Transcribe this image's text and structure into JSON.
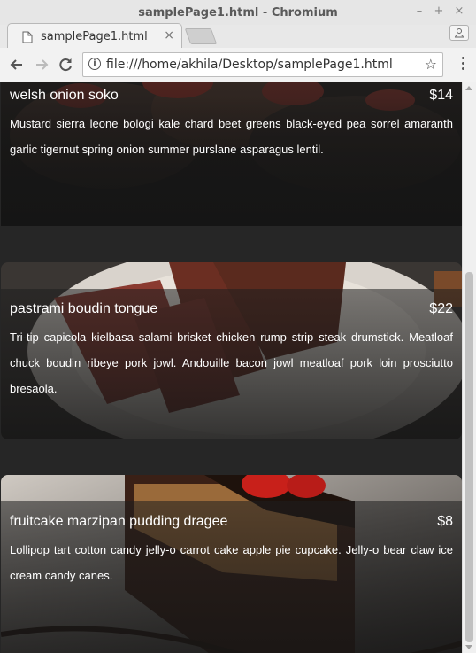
{
  "window": {
    "title": "samplePage1.html - Chromium"
  },
  "tab": {
    "title": "samplePage1.html"
  },
  "omnibox": {
    "url": "file:///home/akhila/Desktop/samplePage1.html"
  },
  "menu": [
    {
      "name": "welsh onion soko",
      "price": "$14",
      "description": "Mustard sierra leone bologi kale chard beet greens black-eyed pea sorrel amaranth garlic tigernut spring onion summer purslane asparagus lentil."
    },
    {
      "name": "pastrami boudin tongue",
      "price": "$22",
      "description": "Tri-tip capicola kielbasa salami brisket chicken rump strip steak drumstick. Meatloaf chuck boudin ribeye pork jowl. Andouille bacon jowl meatloaf pork loin prosciutto bresaola."
    },
    {
      "name": "fruitcake marzipan pudding dragee",
      "price": "$8",
      "description": "Lollipop tart cotton candy jelly-o carrot cake apple pie cupcake. Jelly-o bear claw ice cream candy canes."
    }
  ]
}
